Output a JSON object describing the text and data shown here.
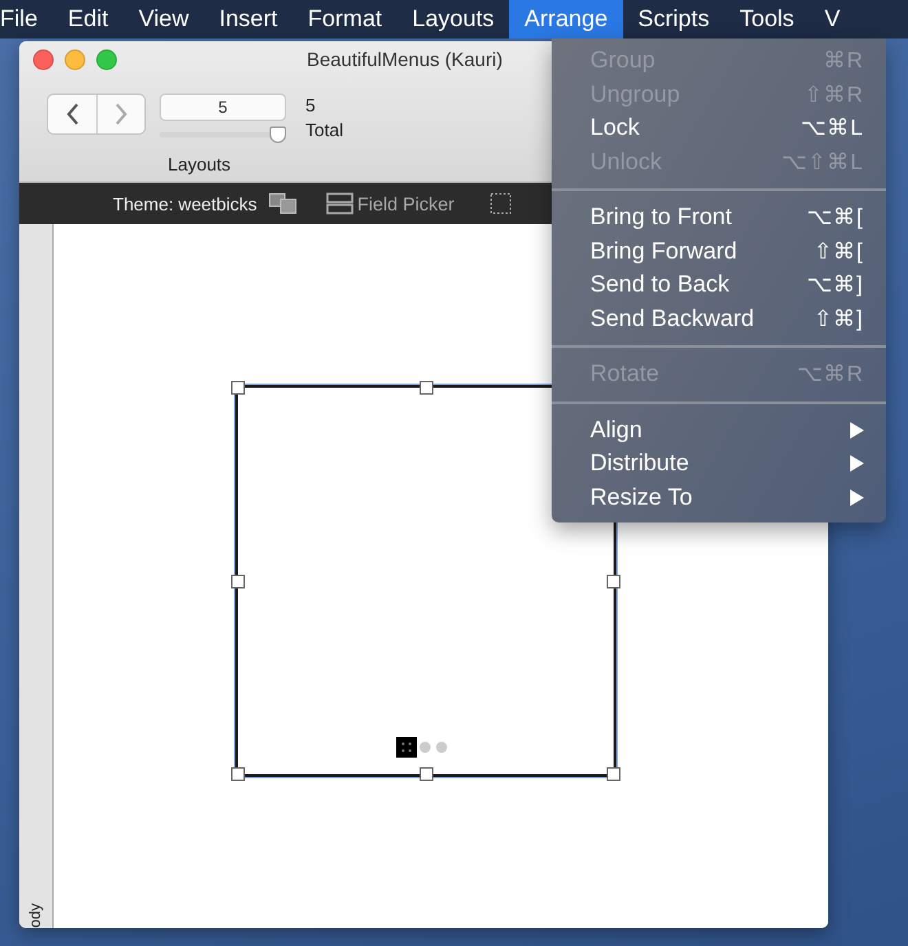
{
  "menubar": {
    "items": [
      {
        "label": "File",
        "selected": false
      },
      {
        "label": "Edit",
        "selected": false
      },
      {
        "label": "View",
        "selected": false
      },
      {
        "label": "Insert",
        "selected": false
      },
      {
        "label": "Format",
        "selected": false
      },
      {
        "label": "Layouts",
        "selected": false
      },
      {
        "label": "Arrange",
        "selected": true
      },
      {
        "label": "Scripts",
        "selected": false
      },
      {
        "label": "Tools",
        "selected": false
      },
      {
        "label": "V",
        "selected": false
      }
    ]
  },
  "window": {
    "title": "BeautifulMenus (Kauri)",
    "layout_field": {
      "value": "5"
    },
    "layout_slider": {
      "level": 1
    },
    "layout_label": "Layouts",
    "total_count": "5",
    "total_label": "Total",
    "theme": "Theme: weetbicks",
    "field_picker": "Field Picker",
    "part_label": "ody"
  },
  "menu": {
    "items": [
      {
        "kind": "item",
        "label": "Group",
        "shortcut": "⌘R",
        "disabled": true,
        "submenu": false
      },
      {
        "kind": "item",
        "label": "Ungroup",
        "shortcut": "⇧⌘R",
        "disabled": true,
        "submenu": false
      },
      {
        "kind": "item",
        "label": "Lock",
        "shortcut": "⌥⌘L",
        "disabled": false,
        "submenu": false
      },
      {
        "kind": "item",
        "label": "Unlock",
        "shortcut": "⌥⇧⌘L",
        "disabled": true,
        "submenu": false
      },
      {
        "kind": "separator"
      },
      {
        "kind": "item",
        "label": "Bring to Front",
        "shortcut": "⌥⌘[",
        "disabled": false,
        "submenu": false
      },
      {
        "kind": "item",
        "label": "Bring Forward",
        "shortcut": "⇧⌘[",
        "disabled": false,
        "submenu": false
      },
      {
        "kind": "item",
        "label": "Send to Back",
        "shortcut": "⌥⌘]",
        "disabled": false,
        "submenu": false
      },
      {
        "kind": "item",
        "label": "Send Backward",
        "shortcut": "⇧⌘]",
        "disabled": false,
        "submenu": false
      },
      {
        "kind": "separator"
      },
      {
        "kind": "item",
        "label": "Rotate",
        "shortcut": "⌥⌘R",
        "disabled": true,
        "submenu": false
      },
      {
        "kind": "separator"
      },
      {
        "kind": "item",
        "label": "Align",
        "disabled": false,
        "submenu": true
      },
      {
        "kind": "item",
        "label": "Distribute",
        "disabled": false,
        "submenu": true
      },
      {
        "kind": "item",
        "label": "Resize To",
        "disabled": false,
        "submenu": true
      }
    ]
  }
}
